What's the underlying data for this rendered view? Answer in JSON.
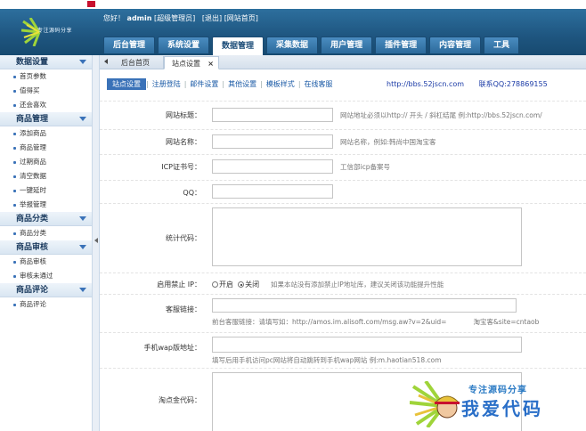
{
  "header": {
    "logo_text": "专注源码分享",
    "welcome": {
      "greeting": "您好！",
      "user": "admin",
      "role": "[超级管理员]",
      "logout": "[退出]",
      "site_home": "[网站首页]"
    },
    "nav": [
      "后台管理",
      "系统设置",
      "数据管理",
      "采集数据",
      "用户管理",
      "插件管理",
      "内容管理",
      "工具"
    ],
    "active_nav": "数据管理"
  },
  "sidebar": {
    "groups": [
      {
        "title": "数据设置",
        "items": [
          "首页参数",
          "值得买",
          "还会喜欢"
        ]
      },
      {
        "title": "商品管理",
        "items": [
          "添加商品",
          "商品管理",
          "过期商品",
          "清空数据",
          "一键延时",
          "举报管理"
        ]
      },
      {
        "title": "商品分类",
        "items": [
          "商品分类"
        ]
      },
      {
        "title": "商品审核",
        "items": [
          "商品审核",
          "审核未通过"
        ]
      },
      {
        "title": "商品评论",
        "items": [
          "商品评论"
        ]
      }
    ]
  },
  "page_tabs": {
    "home": "后台首页",
    "current": "站点设置",
    "close": "×"
  },
  "subtabs": [
    "站点设置",
    "注册登陆",
    "邮件设置",
    "其他设置",
    "模板样式",
    "在线客服"
  ],
  "site_links": {
    "url": "http://bbs.52jscn.com",
    "contact": "联系QQ:278869155"
  },
  "form": {
    "site_title": {
      "label": "网站标题：",
      "hint": "网站地址必须以http:// 开头 / 斜杠结尾 例:http://bbs.52jscn.com/"
    },
    "site_name": {
      "label": "网站名称：",
      "hint": "网站名称，例如:韩尚中国淘宝客"
    },
    "icp": {
      "label": "ICP证书号：",
      "hint": "工信部icp备案号"
    },
    "qq": {
      "label": "QQ："
    },
    "stats_code": {
      "label": "统计代码："
    },
    "ip_ban": {
      "label": "启用禁止 IP：",
      "on": "开启",
      "off": "关闭",
      "selected": "关闭",
      "hint": "如果本站没有添加禁止IP地址库，建议关闭该功能提升性能"
    },
    "service_link": {
      "label": "客服链接：",
      "hint": "前台客服链接：请填写如：http://amos.im.alisoft.com/msg.aw?v=2&uid=　　　　淘宝客&site=cntaob"
    },
    "wap_url": {
      "label": "手机wap版地址：",
      "hint": "填写后用手机访问pc网站将自动跳转到手机wap网站 例:m.haotian518.com"
    },
    "alimama_code": {
      "label": "淘点金代码："
    }
  },
  "watermark": {
    "top": "专注源码分享",
    "bottom": "我爱代码"
  },
  "colors": {
    "header": "#1e557f",
    "accent": "#3a72b8",
    "link": "#1a5aa6"
  }
}
